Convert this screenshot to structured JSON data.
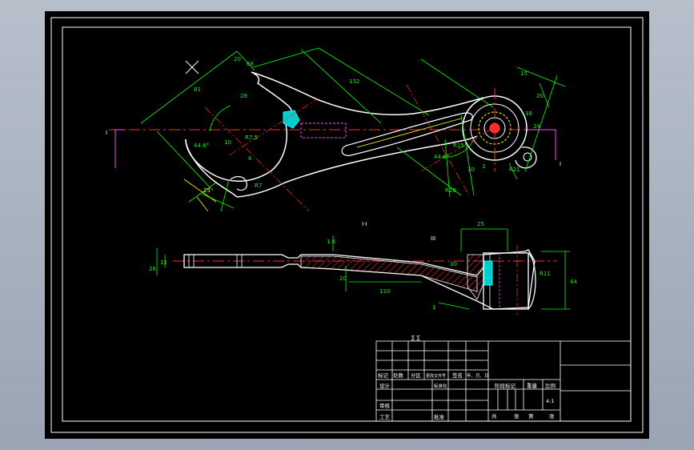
{
  "colors": {
    "background": "#000000",
    "frame": "#ffffff",
    "dimension": "#00ff00",
    "centerline": "#ff2a2a",
    "hidden": "#ff44ff",
    "hatch": "#ff3030",
    "outline": "#ffffff",
    "highlight": "#ffff00",
    "accent": "#00ffff"
  },
  "top_view": {
    "dims": {
      "d68": "68",
      "d81": "81",
      "d20": "20",
      "d28": "28",
      "d132": "132",
      "a44_6": "44.6°",
      "a44_6b": "44.6°",
      "d10": "10",
      "r7_5": "R7.5",
      "d6": "6",
      "d25": "25",
      "r7": "R7",
      "r15": "R15",
      "r26": "R26",
      "d10b": "10",
      "d15": "15",
      "d20b": "20",
      "d18": "18",
      "r21": "R21",
      "d3": "3",
      "d24": "24"
    },
    "section_marks": {
      "left": "I",
      "right": "I",
      "view": "I-I",
      "side": "III"
    }
  },
  "side_view": {
    "dims": {
      "d26": "26",
      "d11": "11",
      "d1_6": "1.6",
      "d110": "110",
      "d10": "10",
      "d25": "25",
      "d44": "44",
      "r11": "R11",
      "d20": "20",
      "d1": "1"
    }
  },
  "title_block": {
    "labels": {
      "mark": "标记",
      "count": "处数",
      "zone": "分区",
      "docno": "更改文件号",
      "sign": "签名",
      "date": "年、月、日",
      "design": "设计",
      "standard": "标准化",
      "stage": "阶段标记",
      "weight": "重量",
      "scale": "比例",
      "check": "审核",
      "process": "工艺",
      "approve": "批准",
      "total": "共",
      "sheets": "张",
      "sheet_no": "第",
      "sheet": "张",
      "scale_value": "4:1",
      "top_mark": "∑ ∑"
    }
  }
}
